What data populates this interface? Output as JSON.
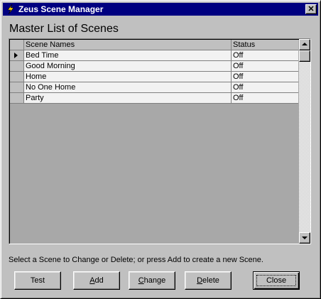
{
  "window": {
    "title": "Zeus Scene Manager",
    "close_glyph": "✕"
  },
  "heading": "Master List of Scenes",
  "grid": {
    "columns": [
      "Scene Names",
      "Status"
    ],
    "rows": [
      {
        "name": "Bed Time",
        "status": "Off",
        "current": true
      },
      {
        "name": "Good Morning",
        "status": "Off",
        "current": false
      },
      {
        "name": "Home",
        "status": "Off",
        "current": false
      },
      {
        "name": "No One Home",
        "status": "Off",
        "current": false
      },
      {
        "name": "Party",
        "status": "Off",
        "current": false
      }
    ]
  },
  "hint": "Select a Scene to Change or Delete; or press Add to create a new Scene.",
  "buttons": {
    "test": {
      "label": "Test",
      "accel": "",
      "rest": "Test"
    },
    "add": {
      "label": "Add",
      "accel": "A",
      "rest": "dd"
    },
    "change": {
      "label": "Change",
      "accel": "C",
      "rest": "hange"
    },
    "delete": {
      "label": "Delete",
      "accel": "D",
      "rest": "elete"
    },
    "close": {
      "label": "Close",
      "accel": "",
      "rest": "Close"
    }
  },
  "icons": {
    "app": "lightning-bolt-icon",
    "current_row": "row-pointer-icon"
  },
  "colors": {
    "titlebar": "#000080",
    "face": "#c0c0c0",
    "grid_bg": "#a8a8a8",
    "row_bg": "#f2f2f2",
    "icon_bolt": "#ffd700"
  }
}
